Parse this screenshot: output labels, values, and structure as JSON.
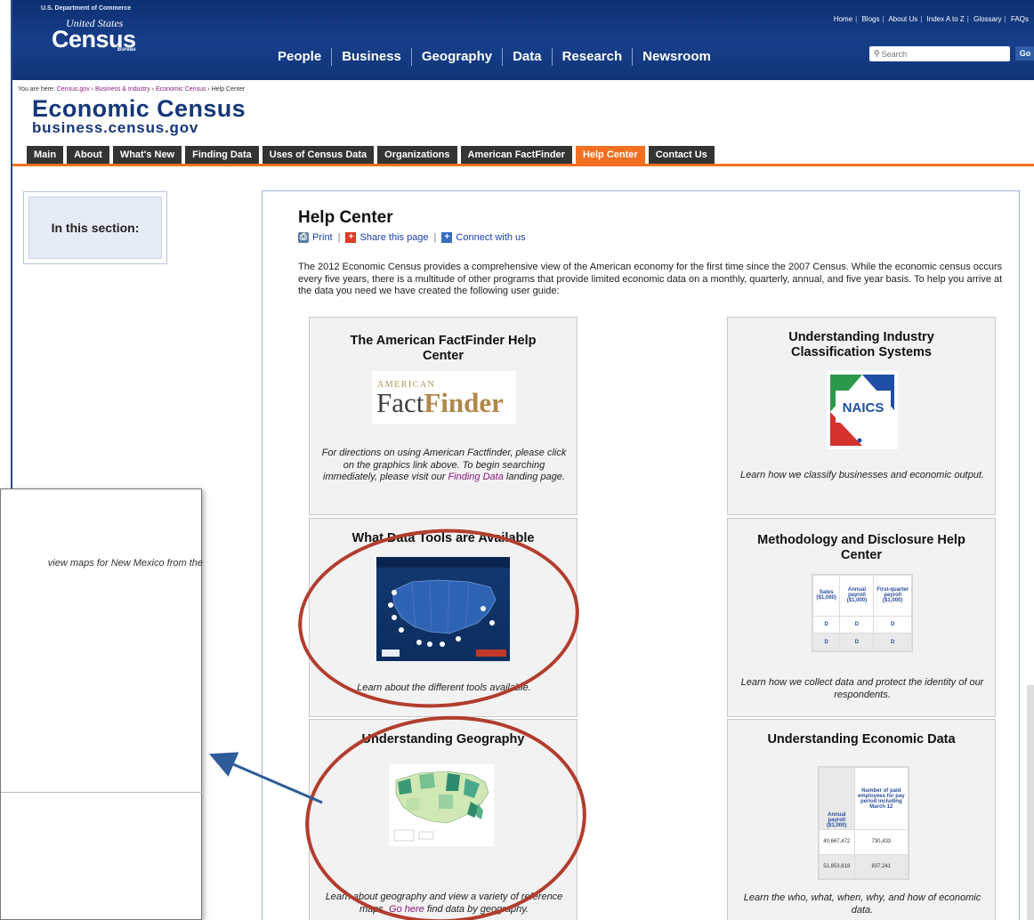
{
  "header": {
    "department": "U.S. Department of Commerce",
    "logo_us": "United States",
    "logo_census": "Census",
    "logo_bureau": "Bureau",
    "top_links": [
      "Home",
      "Blogs",
      "About Us",
      "Index A to Z",
      "Glossary",
      "FAQs"
    ],
    "main_nav": [
      "People",
      "Business",
      "Geography",
      "Data",
      "Research",
      "Newsroom"
    ],
    "search_placeholder": "Search",
    "go_label": "Go"
  },
  "breadcrumb": {
    "prefix": "You are here:",
    "items": [
      "Census.gov",
      "Business & Industry",
      "Economic Census",
      "Help Center"
    ]
  },
  "site": {
    "title": "Economic Census",
    "subtitle": "business.census.gov"
  },
  "tabs": [
    {
      "label": "Main",
      "active": false
    },
    {
      "label": "About",
      "active": false
    },
    {
      "label": "What's New",
      "active": false
    },
    {
      "label": "Finding Data",
      "active": false
    },
    {
      "label": "Uses of Census Data",
      "active": false
    },
    {
      "label": "Organizations",
      "active": false
    },
    {
      "label": "American FactFinder",
      "active": false
    },
    {
      "label": "Help Center",
      "active": true
    },
    {
      "label": "Contact Us",
      "active": false
    }
  ],
  "sidebar": {
    "heading": "In this section:"
  },
  "content": {
    "title": "Help Center",
    "print": "Print",
    "share": "Share this page",
    "connect": "Connect with us",
    "intro": "The 2012 Economic Census provides a comprehensive view of the American economy for the first time since the 2007 Census. While the economic census occurs every five years, there is a multitude of other programs that provide limited economic data on a monthly, quarterly, annual, and five year basis. To help you arrive at the data you need we have created the following user guide:"
  },
  "cards": {
    "factfinder": {
      "title": "The American FactFinder Help Center",
      "logo_top": "AMERICAN",
      "logo_fact": "Fact",
      "logo_finder": "Finder",
      "desc_before": "For directions on using American Factfinder, please click on the graphics link above. To begin searching immediately, please visit our ",
      "desc_link": "Finding Data",
      "desc_after": " landing page."
    },
    "industry": {
      "title": "Understanding Industry Classification Systems",
      "logo_text": "NAICS",
      "desc": "Learn how we classify businesses and economic output."
    },
    "tools": {
      "title": "What Data Tools are Available",
      "desc": "Learn about the different tools available."
    },
    "methodology": {
      "title": "Methodology and Disclosure Help Center",
      "table_headers": [
        "Sales ($1,000)",
        "Annual payroll ($1,000)",
        "First-quarter payroll ($1,000)"
      ],
      "table_rows": [
        [
          "D",
          "D",
          "D"
        ],
        [
          "D",
          "D",
          "D"
        ]
      ],
      "desc": "Learn how we collect data and protect the identity of our respondents."
    },
    "geography": {
      "title": "Understanding Geography",
      "desc_before": "Learn about geography and view a variety of reference maps. ",
      "desc_link": "Go here",
      "desc_after": " find data by geography."
    },
    "economic": {
      "title": "Understanding Economic Data",
      "table_headers": [
        "Annual payroll ($1,000)",
        "Number of paid employees for pay period including March 12"
      ],
      "table_rows": [
        [
          "40,667,472",
          "730,433"
        ],
        [
          "51,853,618",
          "837,241"
        ]
      ],
      "desc": "Learn the who, what, when, why, and how of economic data."
    }
  },
  "popup": {
    "text": "view maps for New Mexico from the"
  },
  "colors": {
    "header_blue": "#0c2f72",
    "tab_dark": "#343434",
    "tab_active": "#f37021",
    "annotation_red": "#b23d2e",
    "arrow_blue": "#2e5c98"
  }
}
